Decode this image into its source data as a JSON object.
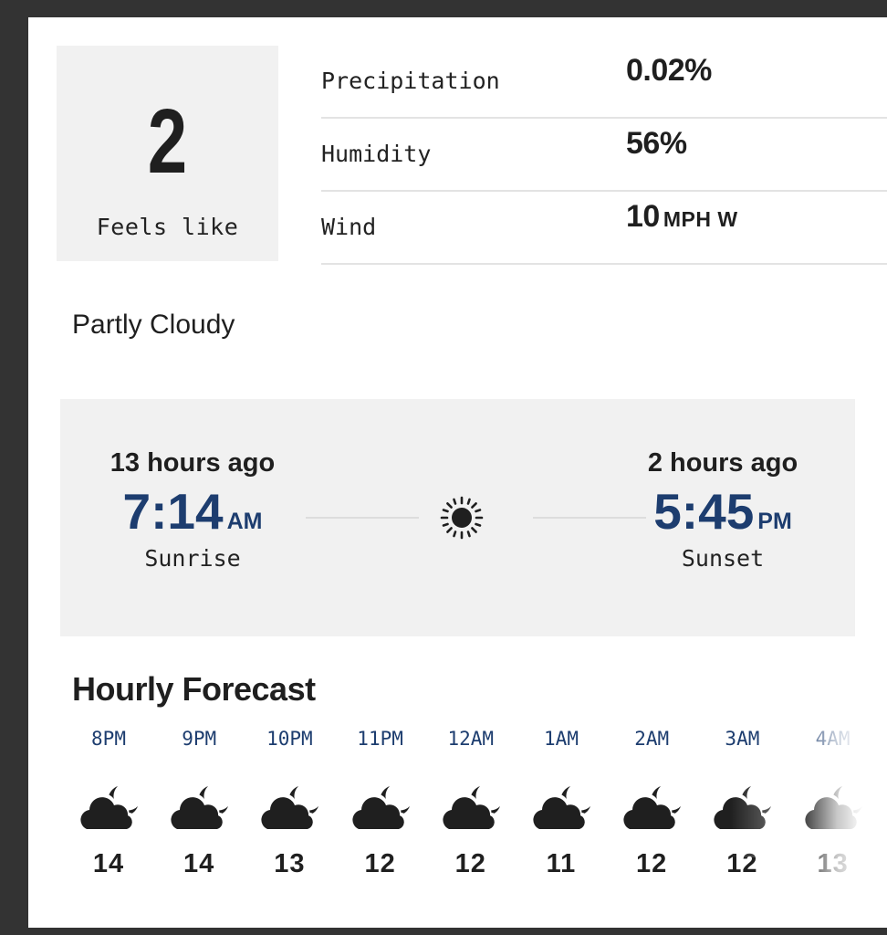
{
  "feels_like": {
    "value": "2",
    "label": "Feels like"
  },
  "details": [
    {
      "label": "Precipitation",
      "value": "0.02%",
      "unit": ""
    },
    {
      "label": "Humidity",
      "value": "56%",
      "unit": ""
    },
    {
      "label": "Wind",
      "value": "10",
      "unit": "MPH W"
    }
  ],
  "condition": "Partly Cloudy",
  "sun": {
    "sunrise": {
      "ago": "13 hours ago",
      "time": "7:14",
      "ampm": "AM",
      "label": "Sunrise"
    },
    "sunset": {
      "ago": "2 hours ago",
      "time": "5:45",
      "ampm": "PM",
      "label": "Sunset"
    },
    "icon": "sun-icon"
  },
  "hourly": {
    "title": "Hourly Forecast",
    "items": [
      {
        "time": "8PM",
        "temp": "14",
        "icon": "partly-cloudy-night-icon"
      },
      {
        "time": "9PM",
        "temp": "14",
        "icon": "partly-cloudy-night-icon"
      },
      {
        "time": "10PM",
        "temp": "13",
        "icon": "partly-cloudy-night-icon"
      },
      {
        "time": "11PM",
        "temp": "12",
        "icon": "partly-cloudy-night-icon"
      },
      {
        "time": "12AM",
        "temp": "12",
        "icon": "partly-cloudy-night-icon"
      },
      {
        "time": "1AM",
        "temp": "11",
        "icon": "partly-cloudy-night-icon"
      },
      {
        "time": "2AM",
        "temp": "12",
        "icon": "partly-cloudy-night-icon"
      },
      {
        "time": "3AM",
        "temp": "12",
        "icon": "partly-cloudy-night-icon"
      },
      {
        "time": "4AM",
        "temp": "13",
        "icon": "partly-cloudy-night-icon"
      }
    ]
  },
  "colors": {
    "accent": "#1d3d6f",
    "panel": "#f1f1f1",
    "frame": "#333333"
  }
}
